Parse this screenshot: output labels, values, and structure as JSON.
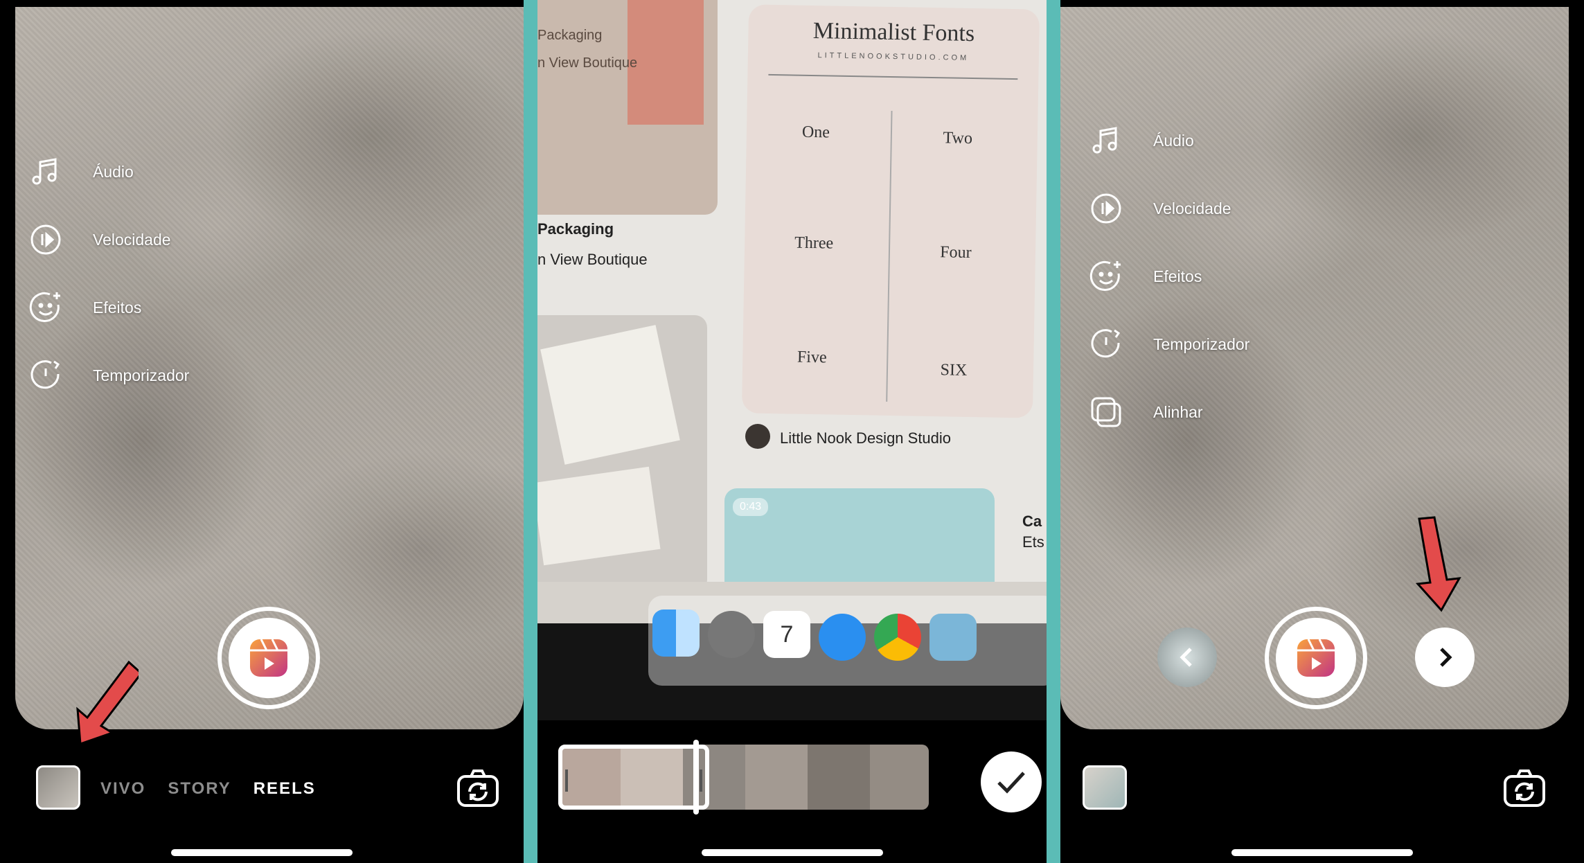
{
  "panels": {
    "left": {
      "tools": [
        {
          "label": "Áudio",
          "icon": "music-note-icon"
        },
        {
          "label": "Velocidade",
          "icon": "speed-icon"
        },
        {
          "label": "Efeitos",
          "icon": "effects-face-icon"
        },
        {
          "label": "Temporizador",
          "icon": "timer-icon"
        }
      ],
      "modes": [
        "VIVO",
        "STORY",
        "REELS"
      ],
      "active_mode": "REELS"
    },
    "middle": {
      "screen_photo": {
        "font_card_title": "Minimalist Fonts",
        "font_card_subtitle": "LITTLENOOKSTUDIO.COM",
        "font_cells": [
          "One",
          "Two",
          "Three",
          "Four",
          "Five",
          "SIX"
        ],
        "pin_label_1": "Packaging",
        "pin_label_2": "n View Boutique",
        "pin_label_3": "Little Nook Design Studio",
        "video_badge": "0:43",
        "card_top_text": "Packaging",
        "card_top_text_2": "n View Boutique",
        "side_label_1": "Ca",
        "side_label_2": "Ets",
        "calendar_day": "7"
      }
    },
    "right": {
      "tools": [
        {
          "label": "Áudio",
          "icon": "music-note-icon"
        },
        {
          "label": "Velocidade",
          "icon": "speed-icon"
        },
        {
          "label": "Efeitos",
          "icon": "effects-face-icon"
        },
        {
          "label": "Temporizador",
          "icon": "timer-icon"
        },
        {
          "label": "Alinhar",
          "icon": "align-icon"
        }
      ]
    }
  },
  "colors": {
    "divider": "#5bbcb6",
    "arrow_red": "#e34b4b",
    "reels_gradient_start": "#f9a23c",
    "reels_gradient_end": "#c13584"
  }
}
